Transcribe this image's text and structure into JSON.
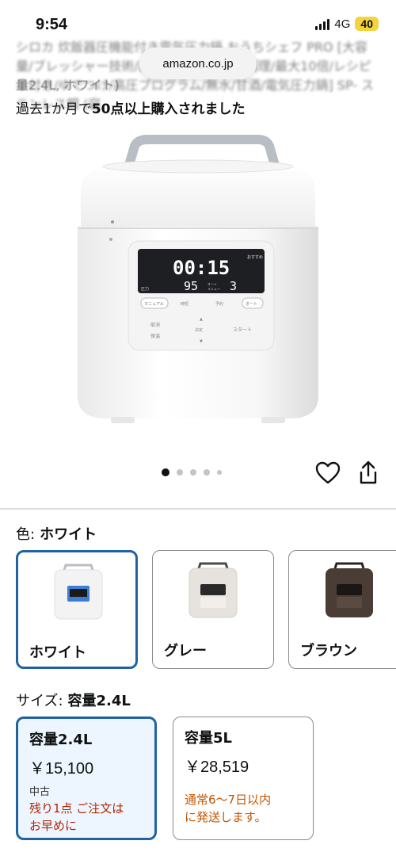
{
  "status": {
    "time": "9:54",
    "network": "4G",
    "battery": "40"
  },
  "page": {
    "title_blurred": "シロカ 炊飯器圧機能付き電気圧力鍋 おうちシェフ PRO [大容量/ブレッシャー技術/高圧力95kpa/自動調理/最大10倍/レシピ本付き/ゆでつけ/高圧プログラム/無水/甘酒/電気圧力鍋] SP-",
    "title_right": "ステンレス鋼 (容",
    "title_line2": "量2.4L, ホワイト)",
    "url": "amazon.co.jp",
    "bought_prefix": "過去1か月で",
    "bought_count": "50点以上購入されました"
  },
  "device_screen": {
    "timer": "00:15",
    "temp": "95",
    "menu": "3",
    "tag": "おすすめ",
    "sub": "圧力",
    "menu_label1": "オート",
    "menu_label2": "メニュー",
    "btn_manual": "マニュアル",
    "btn_time": "時短",
    "btn_reserve": "予約",
    "btn_auto": "オート",
    "btn_cancel": "取消",
    "btn_keep": "保温",
    "btn_decide": "決定",
    "btn_start": "スタート"
  },
  "carousel": {
    "count": 5,
    "active_index": 0
  },
  "color": {
    "label": "色:",
    "selected": "ホワイト",
    "options": [
      {
        "name": "ホワイト",
        "body": "#f3f3f3"
      },
      {
        "name": "グレー",
        "body": "#e6e2dd"
      },
      {
        "name": "ブラウン",
        "body": "#4a3d36"
      }
    ]
  },
  "size": {
    "label": "サイズ:",
    "selected": "容量2.4L",
    "options": [
      {
        "name": "容量2.4L",
        "price": "￥15,100",
        "condition": "中古",
        "stock_line1": "残り1点 ご注文は",
        "stock_line2": "お早めに"
      },
      {
        "name": "容量5L",
        "price": "￥28,519",
        "ship_line1": "通常6～7日以内",
        "ship_line2": "に発送します。"
      }
    ]
  },
  "colors": {
    "accent": "#2162a1",
    "stock_red": "#b12704",
    "ship_orange": "#c45500",
    "battery": "#f4d33b"
  }
}
